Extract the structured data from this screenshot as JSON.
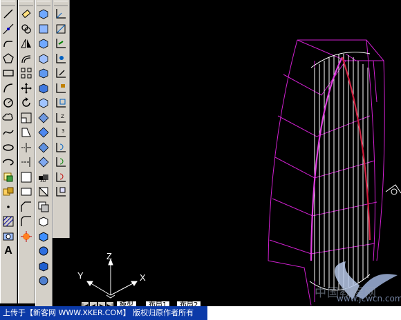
{
  "toolbars": {
    "draw": [
      "line-icon",
      "construction-line-icon",
      "polyline-icon",
      "polygon-icon",
      "rectangle-icon",
      "arc-icon",
      "circle-icon",
      "revision-cloud-icon",
      "spline-icon",
      "ellipse-icon",
      "ellipse-arc-icon",
      "insert-block-icon",
      "make-block-icon",
      "point-icon",
      "hatch-icon",
      "region-icon"
    ],
    "draw_text_label": "A",
    "modify": [
      "erase-icon",
      "copy-icon",
      "mirror-icon",
      "offset-icon",
      "array-icon",
      "move-icon",
      "rotate-icon",
      "scale-icon",
      "stretch-icon",
      "trim-icon",
      "extend-icon",
      "break-icon",
      "join-icon",
      "chamfer-icon",
      "fillet-icon",
      "explode-icon"
    ],
    "solids": [
      "box-icon",
      "sphere-icon",
      "cylinder-icon",
      "cone-icon",
      "wedge-icon",
      "torus-icon",
      "extrude-icon",
      "revolve-icon",
      "slice-icon",
      "section-icon",
      "interfere-icon",
      "setup-drawing-icon",
      "setup-view-icon",
      "setup-profile-icon",
      "union-icon",
      "subtract-icon",
      "intersect-icon",
      "shade-icon",
      "render-icon"
    ],
    "ucs": [
      "ucs-icon",
      "world-ucs-icon",
      "ucs-previous-icon",
      "face-ucs-icon",
      "object-ucs-icon",
      "view-ucs-icon",
      "origin-ucs-icon",
      "zaxis-ucs-icon",
      "3point-ucs-icon",
      "x-rotate-ucs-icon",
      "y-rotate-ucs-icon",
      "z-rotate-ucs-icon",
      "apply-ucs-icon",
      "named-ucs-icon"
    ]
  },
  "ucs_axes": {
    "x": "X",
    "y": "Y",
    "z": "Z"
  },
  "layout_tabs": {
    "model": "模型",
    "layout1": "布局1",
    "layout2": "布局2"
  },
  "watermark": {
    "line1": "中国教程网",
    "line2": "www.jcwcn.com"
  },
  "caption": "上传于【新客网 WWW.XKER.COM】 版权归原作者所有",
  "colors": {
    "wire_magenta": "#d020d0",
    "wire_white": "#ffffff",
    "accent_red": "#d02040",
    "caption_bg": "#0b3aa8"
  }
}
